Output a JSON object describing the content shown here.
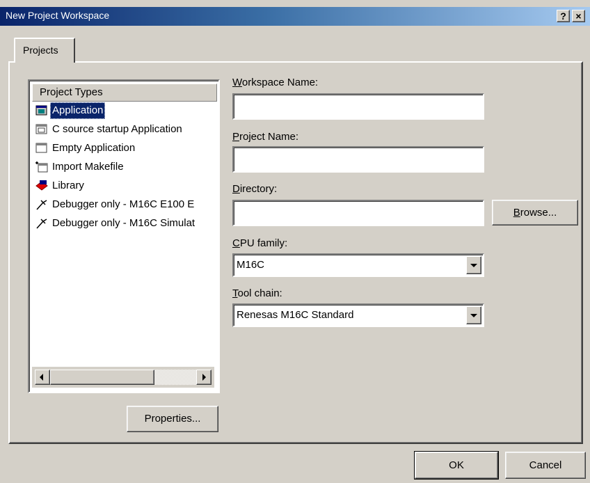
{
  "window": {
    "title": "New Project Workspace",
    "help_button": "?",
    "close_button": "×"
  },
  "tabs": [
    {
      "label": "Projects",
      "active": true
    }
  ],
  "project_types": {
    "header": "Project Types",
    "items": [
      {
        "label": "Application",
        "icon": "application-icon",
        "selected": true
      },
      {
        "label": "C source startup Application",
        "icon": "application-icon",
        "selected": false
      },
      {
        "label": "Empty Application",
        "icon": "application-icon",
        "selected": false
      },
      {
        "label": "Import Makefile",
        "icon": "import-makefile-icon",
        "selected": false
      },
      {
        "label": "Library",
        "icon": "library-icon",
        "selected": false
      },
      {
        "label": "Debugger only - M16C E100 E",
        "icon": "debugger-icon",
        "selected": false
      },
      {
        "label": "Debugger only - M16C Simulat",
        "icon": "debugger-icon",
        "selected": false
      }
    ]
  },
  "form": {
    "workspace_name": {
      "label_mnemonic": "W",
      "label_rest": "orkspace Name:",
      "value": ""
    },
    "project_name": {
      "label_mnemonic": "P",
      "label_rest": "roject Name:",
      "value": ""
    },
    "directory": {
      "label_mnemonic": "D",
      "label_rest": "irectory:",
      "value": ""
    },
    "browse_button": {
      "mnemonic": "B",
      "rest": "rowse..."
    },
    "cpu_family": {
      "label_mnemonic": "C",
      "label_rest": "PU family:",
      "value": "M16C"
    },
    "tool_chain": {
      "label_mnemonic": "T",
      "label_rest": "ool chain:",
      "value": "Renesas M16C Standard"
    }
  },
  "buttons": {
    "properties": "Properties...",
    "ok": "OK",
    "cancel": "Cancel"
  },
  "colors": {
    "title_gradient_start": "#0a246a",
    "title_gradient_end": "#a6caf0",
    "selection": "#0a246a",
    "face": "#d4d0c8"
  }
}
